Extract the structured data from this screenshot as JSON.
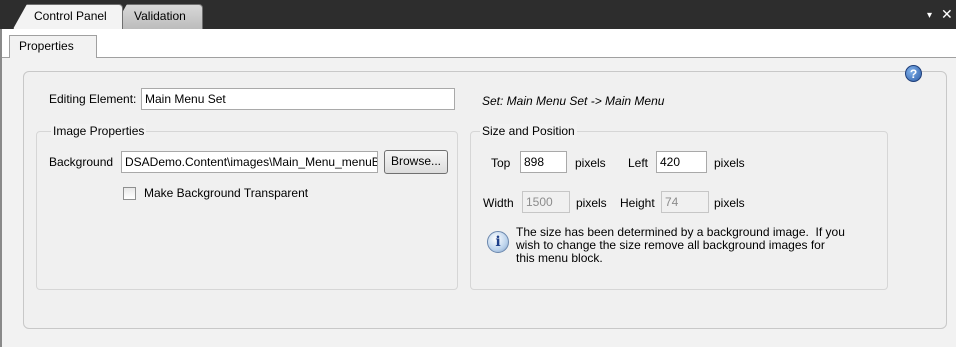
{
  "tabs": {
    "control_panel": "Control Panel",
    "validation": "Validation"
  },
  "window": {
    "dropdown_glyph": "▾",
    "close_glyph": "✕"
  },
  "inner_tabs": {
    "properties": "Properties"
  },
  "help_icon": "?",
  "editing": {
    "label": "Editing Element:",
    "value": "Main Menu Set",
    "set_path": "Set: Main Menu Set -> Main Menu"
  },
  "image_properties": {
    "title": "Image Properties",
    "background_label": "Background",
    "background_value": "DSADemo.Content\\images\\Main_Menu_menuB",
    "browse_button": "Browse...",
    "transparent_label": "Make Background Transparent",
    "transparent_checked": false
  },
  "size_position": {
    "title": "Size and Position",
    "top_label": "Top",
    "top_value": "898",
    "top_unit": "pixels",
    "left_label": "Left",
    "left_value": "420",
    "left_unit": "pixels",
    "width_label": "Width",
    "width_value": "1500",
    "width_unit": "pixels",
    "height_label": "Height",
    "height_value": "74",
    "height_unit": "pixels",
    "info_icon": "i",
    "info_text": "The size has been determined by a background image.  If you\nwish to change the size remove all background images for\nthis menu block."
  },
  "colors": {
    "titlebar": "#2d2d2d",
    "panel": "#f2f2f2",
    "help_icon": "#2f5fa8"
  }
}
